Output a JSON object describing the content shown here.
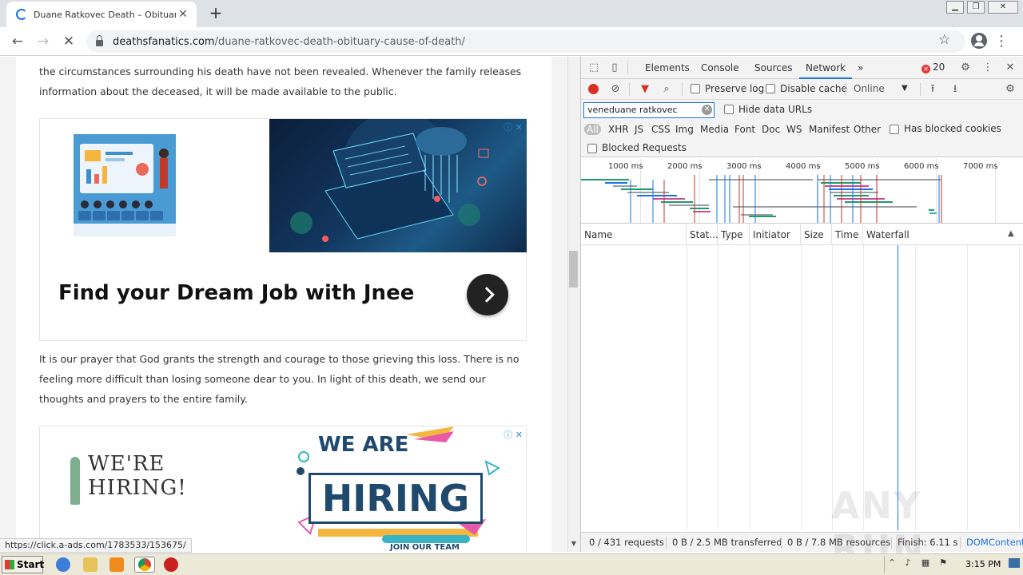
{
  "browser": {
    "tab_title": "Duane Ratkovec Death – Obituary, C",
    "new_tab_label": "+",
    "url_domain": "deathsfanatics.com",
    "url_path": "/duane-ratkovec-death-obituary-cause-of-death/",
    "status_url": "https://click.a-ads.com/1783533/153675/"
  },
  "article": {
    "para1": "the circumstances surrounding his death have not been revealed. Whenever the family releases information about the deceased, it will be made available to the public.",
    "para2": "It is our prayer that God grants the strength and courage to those grieving this loss. There is no feeling more difficult than losing someone dear to you. In light of this death, we send our thoughts and prayers to the entire family.",
    "ad1_headline": "Find your Dream Job with Jnee",
    "ad2_left_text_line1": "WE'RE",
    "ad2_left_text_line2": "HIRING!",
    "ad2_weare": "WE ARE",
    "ad2_hiring": "HIRING",
    "ad2_join": "JOIN OUR TEAM",
    "adchoices_icon": "ⓘ ✕"
  },
  "devtools": {
    "tabs": [
      "Elements",
      "Console",
      "Sources",
      "Network"
    ],
    "active_tab": "Network",
    "more_tabs": "»",
    "error_count": "20",
    "preserve_log": "Preserve log",
    "disable_cache": "Disable cache",
    "throttle": "Online",
    "filter_value": "veneduane ratkovec",
    "hide_data_urls": "Hide data URLs",
    "filter_types": [
      "All",
      "XHR",
      "JS",
      "CSS",
      "Img",
      "Media",
      "Font",
      "Doc",
      "WS",
      "Manifest",
      "Other"
    ],
    "has_blocked_cookies": "Has blocked cookies",
    "blocked_requests": "Blocked Requests",
    "timeline_ticks": [
      "1000 ms",
      "2000 ms",
      "3000 ms",
      "4000 ms",
      "5000 ms",
      "6000 ms",
      "7000 ms"
    ],
    "columns": [
      "Name",
      "Stat...",
      "Type",
      "Initiator",
      "Size",
      "Time",
      "Waterfall"
    ],
    "footer": {
      "requests": "0 / 431 requests",
      "transferred": "0 B / 2.5 MB transferred",
      "resources": "0 B / 7.8 MB resources",
      "finish": "Finish: 6.11 s",
      "domcontent": "DOMContent"
    }
  },
  "taskbar": {
    "start_label": "Start",
    "clock": "3:15 PM"
  },
  "watermark": "ANY RUN",
  "colors": {
    "accent": "#1a73e8",
    "record": "#d93025",
    "devtools_bg": "#f3f3f3"
  }
}
